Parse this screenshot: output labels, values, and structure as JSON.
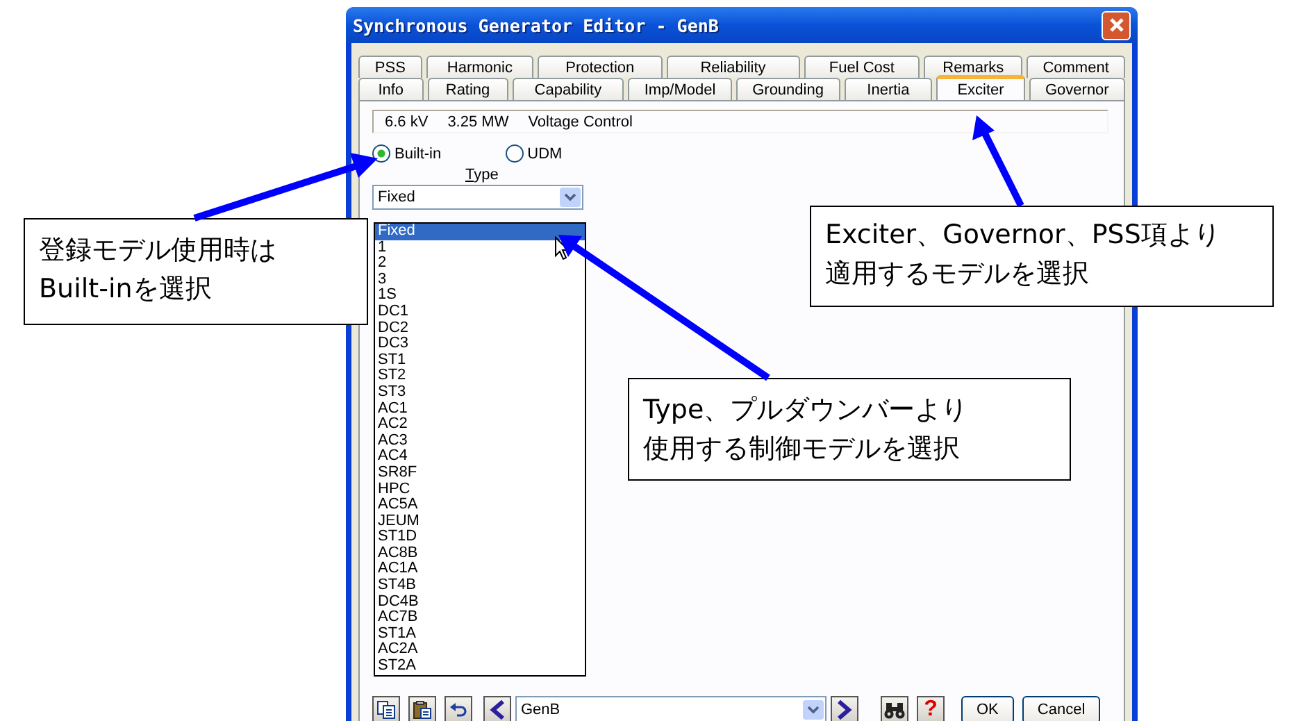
{
  "window": {
    "title": "Synchronous Generator Editor - GenB"
  },
  "tabs_back": [
    {
      "label": "PSS",
      "selected": false
    },
    {
      "label": "Harmonic",
      "selected": false
    },
    {
      "label": "Protection",
      "selected": false
    },
    {
      "label": "Reliability",
      "selected": false
    },
    {
      "label": "Fuel Cost",
      "selected": false
    },
    {
      "label": "Remarks",
      "selected": false
    },
    {
      "label": "Comment",
      "selected": false
    }
  ],
  "tabs_front": [
    {
      "label": "Info",
      "selected": false
    },
    {
      "label": "Rating",
      "selected": false
    },
    {
      "label": "Capability",
      "selected": false
    },
    {
      "label": "Imp/Model",
      "selected": false
    },
    {
      "label": "Grounding",
      "selected": false
    },
    {
      "label": "Inertia",
      "selected": false
    },
    {
      "label": "Exciter",
      "selected": true
    },
    {
      "label": "Governor",
      "selected": false
    }
  ],
  "info": [
    "6.6 kV",
    "3.25 MW",
    "Voltage Control"
  ],
  "source_options": [
    {
      "label": "Built-in",
      "selected": true
    },
    {
      "label": "UDM",
      "selected": false
    }
  ],
  "type_field": {
    "label": "Type",
    "value": "Fixed",
    "expanded": true,
    "options": [
      {
        "label": "Fixed",
        "selected": true
      },
      {
        "label": "1",
        "selected": false
      },
      {
        "label": "2",
        "selected": false
      },
      {
        "label": "3",
        "selected": false
      },
      {
        "label": "1S",
        "selected": false
      },
      {
        "label": "DC1",
        "selected": false
      },
      {
        "label": "DC2",
        "selected": false
      },
      {
        "label": "DC3",
        "selected": false
      },
      {
        "label": "ST1",
        "selected": false
      },
      {
        "label": "ST2",
        "selected": false
      },
      {
        "label": "ST3",
        "selected": false
      },
      {
        "label": "AC1",
        "selected": false
      },
      {
        "label": "AC2",
        "selected": false
      },
      {
        "label": "AC3",
        "selected": false
      },
      {
        "label": "AC4",
        "selected": false
      },
      {
        "label": "SR8F",
        "selected": false
      },
      {
        "label": "HPC",
        "selected": false
      },
      {
        "label": "AC5A",
        "selected": false
      },
      {
        "label": "JEUM",
        "selected": false
      },
      {
        "label": "ST1D",
        "selected": false
      },
      {
        "label": "AC8B",
        "selected": false
      },
      {
        "label": "AC1A",
        "selected": false
      },
      {
        "label": "ST4B",
        "selected": false
      },
      {
        "label": "DC4B",
        "selected": false
      },
      {
        "label": "AC7B",
        "selected": false
      },
      {
        "label": "ST1A",
        "selected": false
      },
      {
        "label": "AC2A",
        "selected": false
      },
      {
        "label": "ST2A",
        "selected": false
      }
    ]
  },
  "footer": {
    "record": "GenB",
    "help": "?",
    "buttons": [
      "OK",
      "Cancel"
    ]
  },
  "callouts": [
    {
      "lines": [
        "登録モデル使用時は",
        "Built-inを選択"
      ]
    },
    {
      "lines": [
        "Exciter、Governor、PSS項より",
        "適用するモデルを選択"
      ]
    },
    {
      "lines": [
        "Type、プルダウンバーより",
        "使用する制御モデルを選択"
      ]
    }
  ]
}
